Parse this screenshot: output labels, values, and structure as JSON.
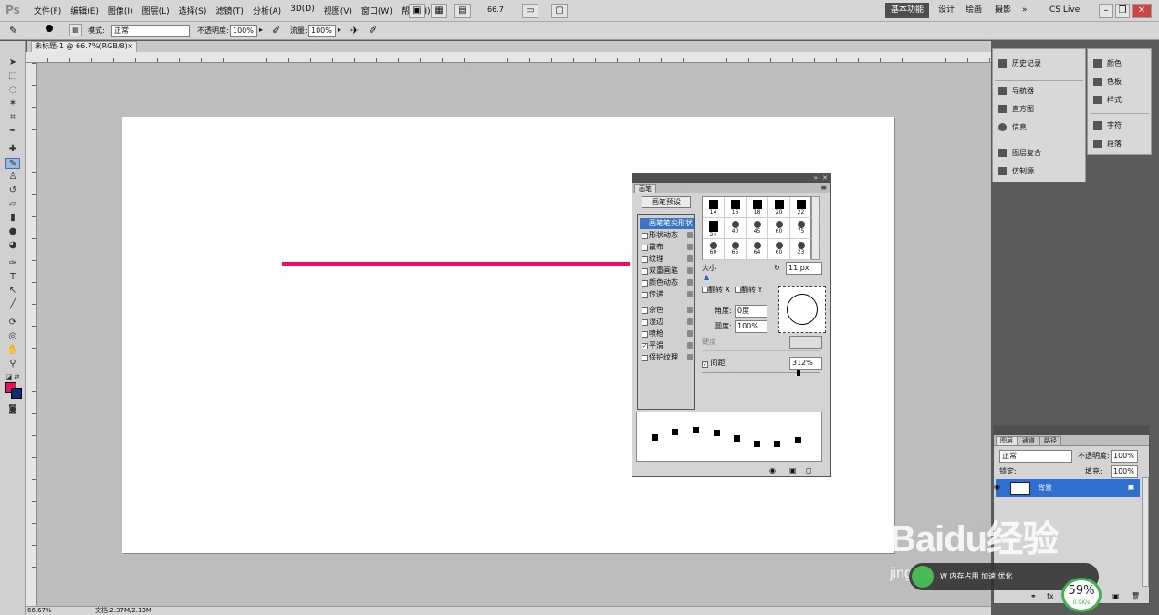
{
  "app": {
    "logo": "Ps",
    "menu": [
      "文件(F)",
      "编辑(E)",
      "图像(I)",
      "图层(L)",
      "选择(S)",
      "滤镜(T)",
      "分析(A)",
      "3D(D)",
      "视图(V)",
      "窗口(W)",
      "帮助(H)"
    ],
    "zoom_display": "66.7",
    "workspace": {
      "active": "基本功能",
      "design": "设计",
      "painting": "绘画",
      "photography": "摄影",
      "more": "»",
      "cslive": "CS Live"
    }
  },
  "options": {
    "mode_label": "模式:",
    "mode_value": "正常",
    "opacity_label": "不透明度:",
    "opacity_value": "100%",
    "flow_label": "流量:",
    "flow_value": "100%"
  },
  "document": {
    "tab_label": "未标题-1 @ 66.7%(RGB/8)",
    "tab_close": "×",
    "stroke_color": "#ec0e63",
    "status_zoom": "66.67%",
    "status_doc": "文档:2.37M/2.13M"
  },
  "colors": {
    "foreground": "#ec0e63",
    "background": "#102a72"
  },
  "brush_panel": {
    "tab": "画笔",
    "presets_button": "画笔预设",
    "options": [
      {
        "label": "画笔笔尖形状",
        "checked": false,
        "selected": true
      },
      {
        "label": "形状动态",
        "checked": false
      },
      {
        "label": "散布",
        "checked": false
      },
      {
        "label": "纹理",
        "checked": false
      },
      {
        "label": "双重画笔",
        "checked": false
      },
      {
        "label": "颜色动态",
        "checked": false
      },
      {
        "label": "传递",
        "checked": false
      },
      {
        "label": "杂色",
        "checked": false
      },
      {
        "label": "湿边",
        "checked": false
      },
      {
        "label": "喷枪",
        "checked": false
      },
      {
        "label": "平滑",
        "checked": true
      },
      {
        "label": "保护纹理",
        "checked": false
      }
    ],
    "tips": [
      "14",
      "16",
      "18",
      "20",
      "22",
      "24",
      "40",
      "45",
      "60",
      "75",
      "60",
      "65",
      "64",
      "60",
      "23"
    ],
    "size_label": "大小",
    "size_value": "11 px",
    "flip_x": "翻转 X",
    "flip_y": "翻转 Y",
    "angle_label": "角度:",
    "angle_value": "0度",
    "roundness_label": "圆度:",
    "roundness_value": "100%",
    "hardness_label": "硬度",
    "spacing_label": "间距",
    "spacing_value": "312%"
  },
  "dock": {
    "col1": [
      "历史记录",
      "导航器",
      "直方图",
      "信息",
      "图层复合",
      "仿制源"
    ],
    "col2": [
      "颜色",
      "色板",
      "样式",
      "字符",
      "段落"
    ]
  },
  "layers_panel": {
    "tabs": [
      "图层",
      "通道",
      "路径"
    ],
    "blend_mode": "正常",
    "opacity_label": "不透明度:",
    "opacity_value": "100%",
    "lock_label": "锁定:",
    "fill_label": "填充:",
    "fill_value": "100%",
    "layer_name": "背景"
  },
  "overlay": {
    "watermark_main": "Baidu经验",
    "watermark_sub": "jingyan.baidu.com",
    "toast_text": "W 内存占用 加速 优化",
    "badge_percent": "59%",
    "badge_speed": "0.9K/s"
  }
}
